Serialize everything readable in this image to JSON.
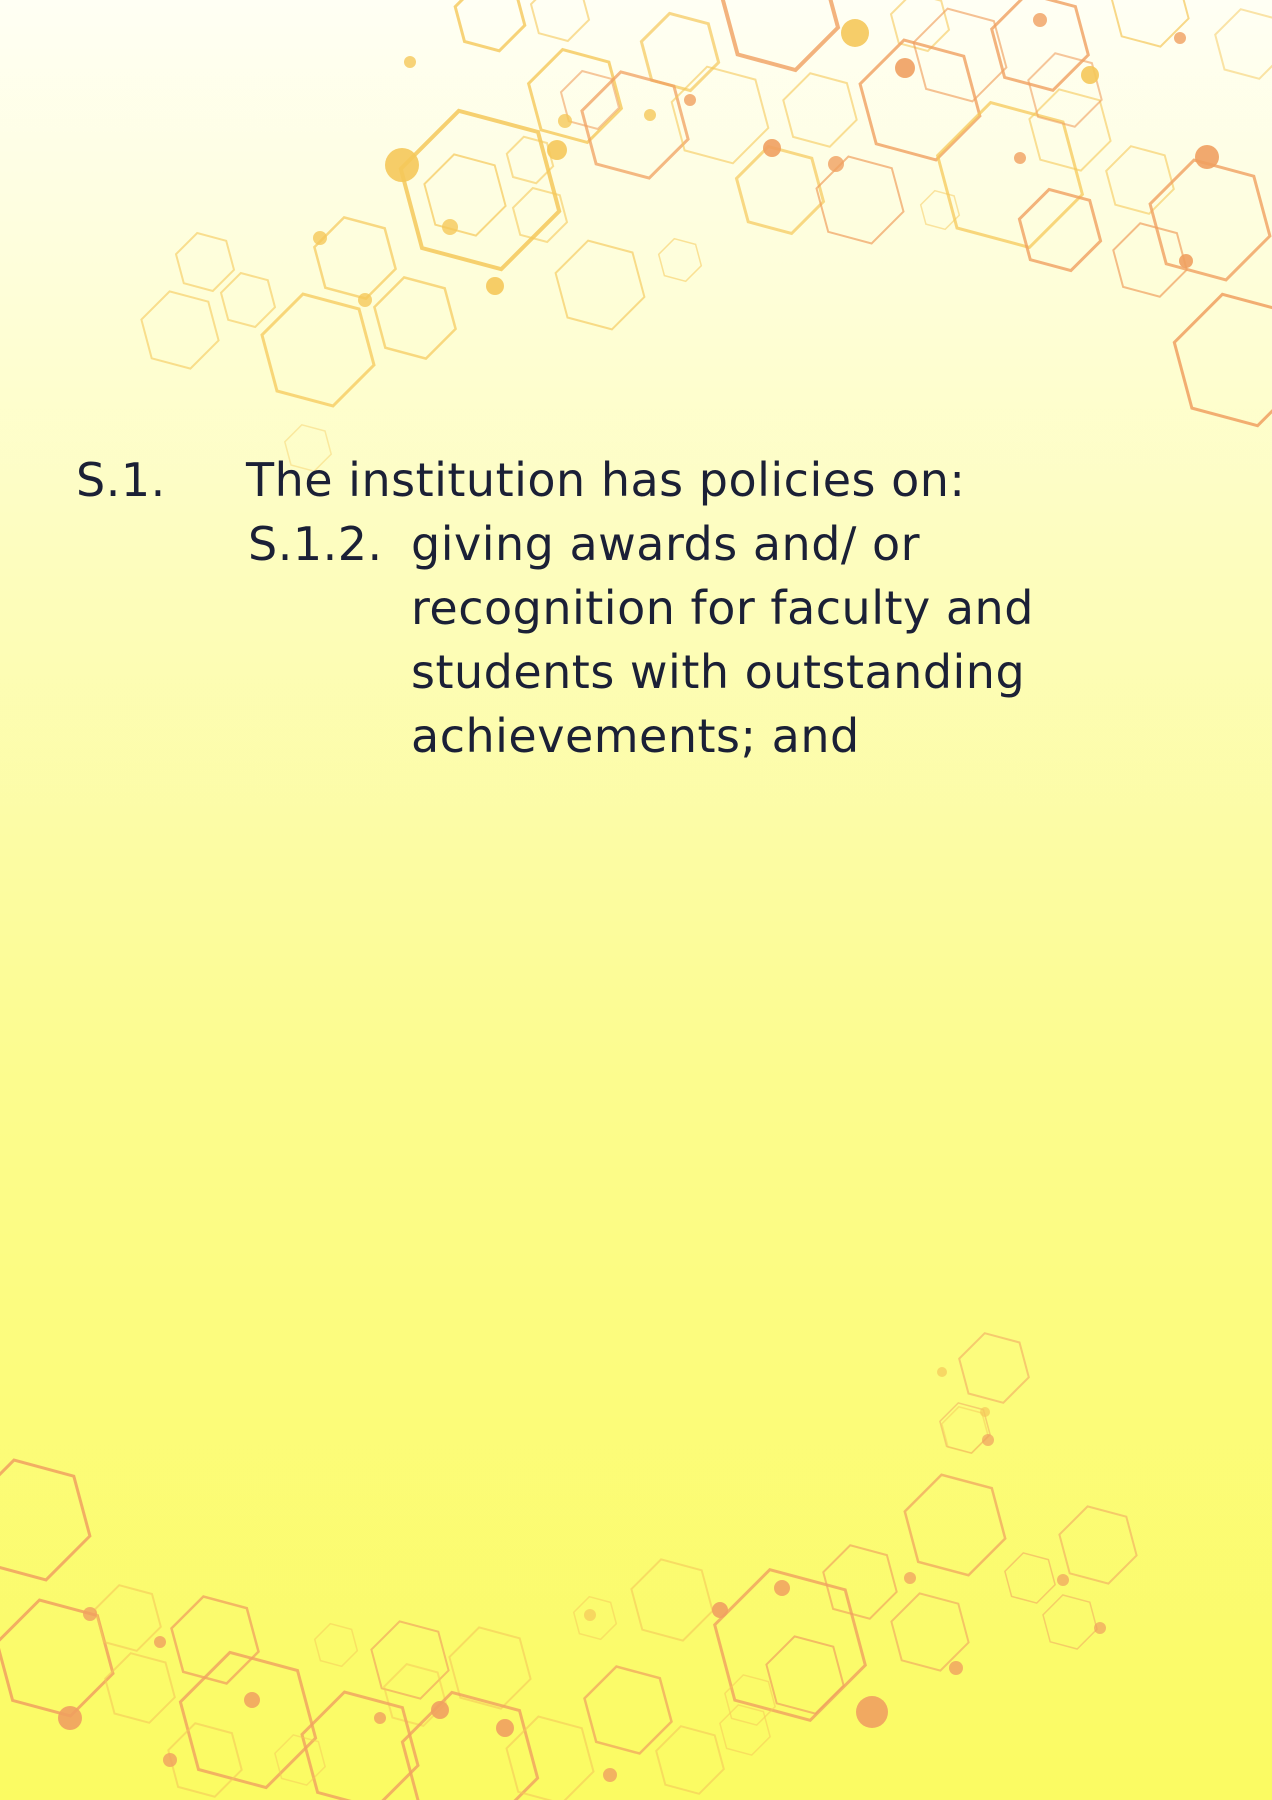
{
  "section": {
    "number": "S.1.",
    "text": "The institution has policies on:"
  },
  "subsection": {
    "number": "S.1.2.",
    "lines": [
      "giving awards and/ or",
      "recognition for faculty and",
      "students with outstanding",
      "achievements; and"
    ]
  },
  "colors": {
    "text": "#1b2036",
    "hex_yellow": "#f5c85a",
    "hex_orange": "#f0a060"
  }
}
